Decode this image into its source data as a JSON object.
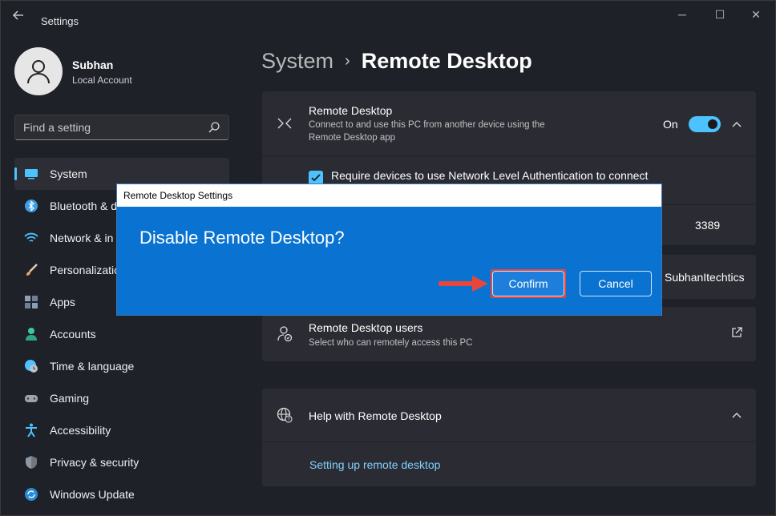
{
  "window": {
    "title": "Settings",
    "controls": {
      "minimize": "─",
      "maximize": "☐",
      "close": "✕"
    }
  },
  "profile": {
    "name": "Subhan",
    "account_type": "Local Account"
  },
  "search": {
    "placeholder": "Find a setting"
  },
  "sidebar": {
    "items": [
      {
        "label": "System",
        "icon": "system-icon",
        "active": true
      },
      {
        "label": "Bluetooth & d",
        "icon": "bluetooth-icon"
      },
      {
        "label": "Network & in",
        "icon": "network-icon"
      },
      {
        "label": "Personalizatio",
        "icon": "brush-icon"
      },
      {
        "label": "Apps",
        "icon": "apps-icon"
      },
      {
        "label": "Accounts",
        "icon": "accounts-icon"
      },
      {
        "label": "Time & language",
        "icon": "time-language-icon"
      },
      {
        "label": "Gaming",
        "icon": "gaming-icon"
      },
      {
        "label": "Accessibility",
        "icon": "accessibility-icon"
      },
      {
        "label": "Privacy & security",
        "icon": "shield-icon"
      },
      {
        "label": "Windows Update",
        "icon": "update-icon"
      }
    ]
  },
  "breadcrumb": {
    "parent": "System",
    "separator": "›",
    "current": "Remote Desktop"
  },
  "remote_desktop": {
    "title": "Remote Desktop",
    "description": "Connect to and use this PC from another device using the Remote Desktop app",
    "toggle_state": "On",
    "nla_label": "Require devices to use Network Level Authentication to connect",
    "port_value": "3389",
    "pc_name_value": "SubhanItechtics"
  },
  "users": {
    "title": "Remote Desktop users",
    "description": "Select who can remotely access this PC"
  },
  "help": {
    "title": "Help with Remote Desktop",
    "link": "Setting up remote desktop"
  },
  "dialog": {
    "title": "Remote Desktop Settings",
    "message": "Disable Remote Desktop?",
    "confirm_label": "Confirm",
    "cancel_label": "Cancel"
  },
  "colors": {
    "accent": "#4cc2ff",
    "dialog_bg": "#0a73d1",
    "highlight": "#e8463a"
  }
}
